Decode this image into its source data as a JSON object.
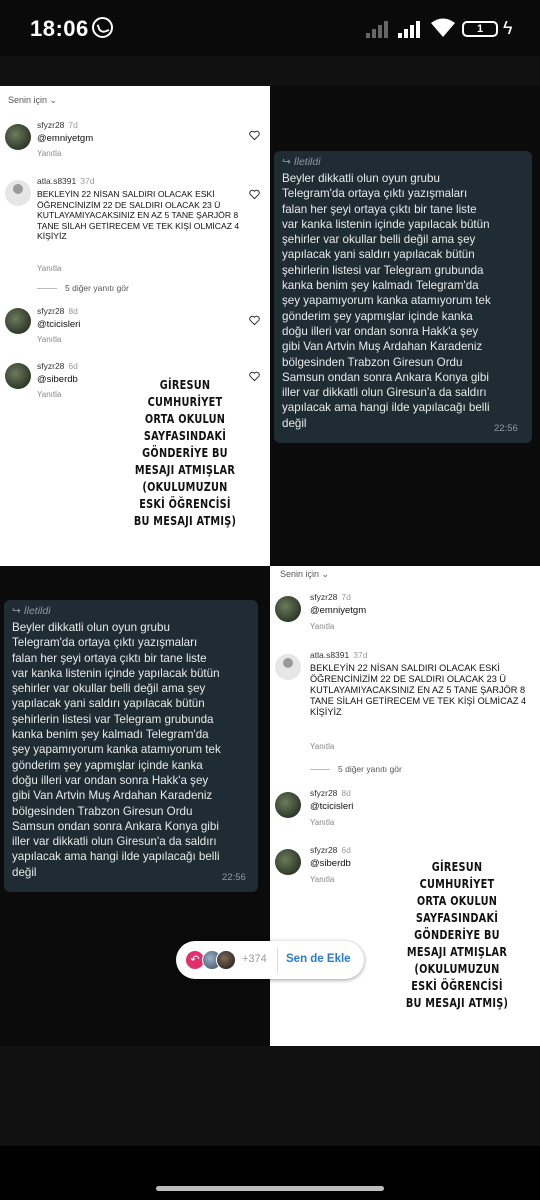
{
  "status_bar": {
    "time": "18:06",
    "battery": "1"
  },
  "panel_top_left": {
    "feed_label": "Senin için",
    "comments": [
      {
        "user": "sfyzr28",
        "age": "7d",
        "text": "@emniyetgm",
        "reply": "Yanıtla"
      },
      {
        "user": "atla.s8391",
        "age": "37d",
        "text": "BEKLEYİN 22 NİSAN SALDIRI OLACAK ESKİ ÖĞRENCİNİZİM 22 DE SALDIRI OLACAK 23 Ü KUTLAYAMIYACAKSINIZ EN AZ 5 TANE ŞARJÖR 8 TANE SİLAH GETİRECEM VE TEK KİŞİ OLMİCAZ 4 KİŞİYİZ",
        "reply": "Yanıtla"
      },
      {
        "user": "sfyzr28",
        "age": "8d",
        "text": "@tcicisleri",
        "reply": "Yanıtla"
      },
      {
        "user": "sfyzr28",
        "age": "6d",
        "text": "@siberdb",
        "reply": "Yanıtla"
      }
    ],
    "more_replies": "5 diğer yanıtı gör",
    "handwritten_note": [
      "GİRESUN",
      "CUMHURİYET",
      "ORTA OKULUN",
      "SAYFASINDAKİ",
      "GÖNDERİYE BU",
      "MESAJI ATMIŞLAR",
      "(OKULUMUZUN",
      "ESKİ ÖĞRENCİSİ",
      "BU MESAJI ATMIŞ)"
    ]
  },
  "panel_top_right": {
    "forwarded_label": "İletildi",
    "message_lines": [
      "Beyler dikkatli olun oyun grubu",
      "Telegram'da ortaya çıktı yazışmaları",
      "falan her şeyi ortaya çıktı bir tane liste",
      "var kanka listenin içinde yapılacak bütün",
      "şehirler var okullar belli değil ama şey",
      "yapılacak yani saldırı yapılacak bütün",
      "şehirlerin listesi var Telegram grubunda",
      "kanka benim şey kalmadı Telegram'da",
      "şey yapamıyorum kanka atamıyorum tek",
      "gönderim şey yapmışlar içinde kanka",
      "doğu illeri var ondan sonra Hakk'a şey",
      "gibi Van Artvin Muş Ardahan Karadeniz",
      "bölgesinden Trabzon Giresun Ordu",
      "Samsun ondan sonra Ankara Konya gibi",
      "iller var dikkatli olun Giresun'a da saldırı",
      "yapılacak ama hangi ilde yapılacağı belli",
      "değil"
    ],
    "time": "22:56"
  },
  "panel_bottom_left": {
    "forwarded_label": "İletildi",
    "message_lines": [
      "Beyler dikkatli olun oyun grubu",
      "Telegram'da ortaya çıktı yazışmaları",
      "falan her şeyi ortaya çıktı bir tane liste",
      "var kanka listenin içinde yapılacak bütün",
      "şehirler var okullar belli değil ama şey",
      "yapılacak yani saldırı yapılacak bütün",
      "şehirlerin listesi var Telegram grubunda",
      "kanka benim şey kalmadı Telegram'da",
      "şey yapamıyorum kanka atamıyorum tek",
      "gönderim şey yapmışlar içinde kanka",
      "doğu illeri var ondan sonra Hakk'a şey",
      "gibi Van Artvin Muş Ardahan Karadeniz",
      "bölgesinden Trabzon Giresun Ordu",
      "Samsun ondan sonra Ankara Konya gibi",
      "iller var dikkatli olun Giresun'a da saldırı",
      "yapılacak ama hangi ilde yapılacağı belli",
      "değil"
    ],
    "time": "22:56"
  },
  "panel_bottom_right": {
    "feed_label": "Senin için",
    "comments": [
      {
        "user": "sfyzr28",
        "age": "7d",
        "text": "@emniyetgm",
        "reply": "Yanıtla"
      },
      {
        "user": "atla.s8391",
        "age": "37d",
        "text": "BEKLEYİN 22 NİSAN SALDIRI OLACAK ESKİ ÖĞRENCİNİZİM 22 DE SALDIRI OLACAK 23 Ü KUTLAYAMIYACAKSINIZ EN AZ 5 TANE ŞARJÖR 8 TANE SİLAH GETİRECEM VE TEK KİŞİ OLMİCAZ 4 KİŞİYİZ",
        "reply": "Yanıtla"
      },
      {
        "user": "sfyzr28",
        "age": "8d",
        "text": "@tcicisleri",
        "reply": "Yanıtla"
      },
      {
        "user": "sfyzr28",
        "age": "6d",
        "text": "@siberdb",
        "reply": "Yanıtla"
      }
    ],
    "more_replies": "5 diğer yanıtı gör",
    "handwritten_note": [
      "GİRESUN",
      "CUMHURİYET",
      "ORTA OKULUN",
      "SAYFASINDAKİ",
      "GÖNDERİYE BU",
      "MESAJI ATMIŞLAR",
      "(OKULUMUZUN",
      "ESKİ ÖĞRENCİSİ",
      "BU MESAJI ATMIŞ)"
    ]
  },
  "viewers_pill": {
    "count": "+374",
    "action_label": "Sen de Ekle"
  },
  "icons": [
    "whatsapp-icon",
    "signal-icon",
    "wifi-icon",
    "battery-icon",
    "charging-icon",
    "heart-icon",
    "forward-icon",
    "share-icon"
  ],
  "colors": {
    "accent_link": "#2a7ad6",
    "share_pink": "#e1306c",
    "bubble": "#1f2c33"
  }
}
